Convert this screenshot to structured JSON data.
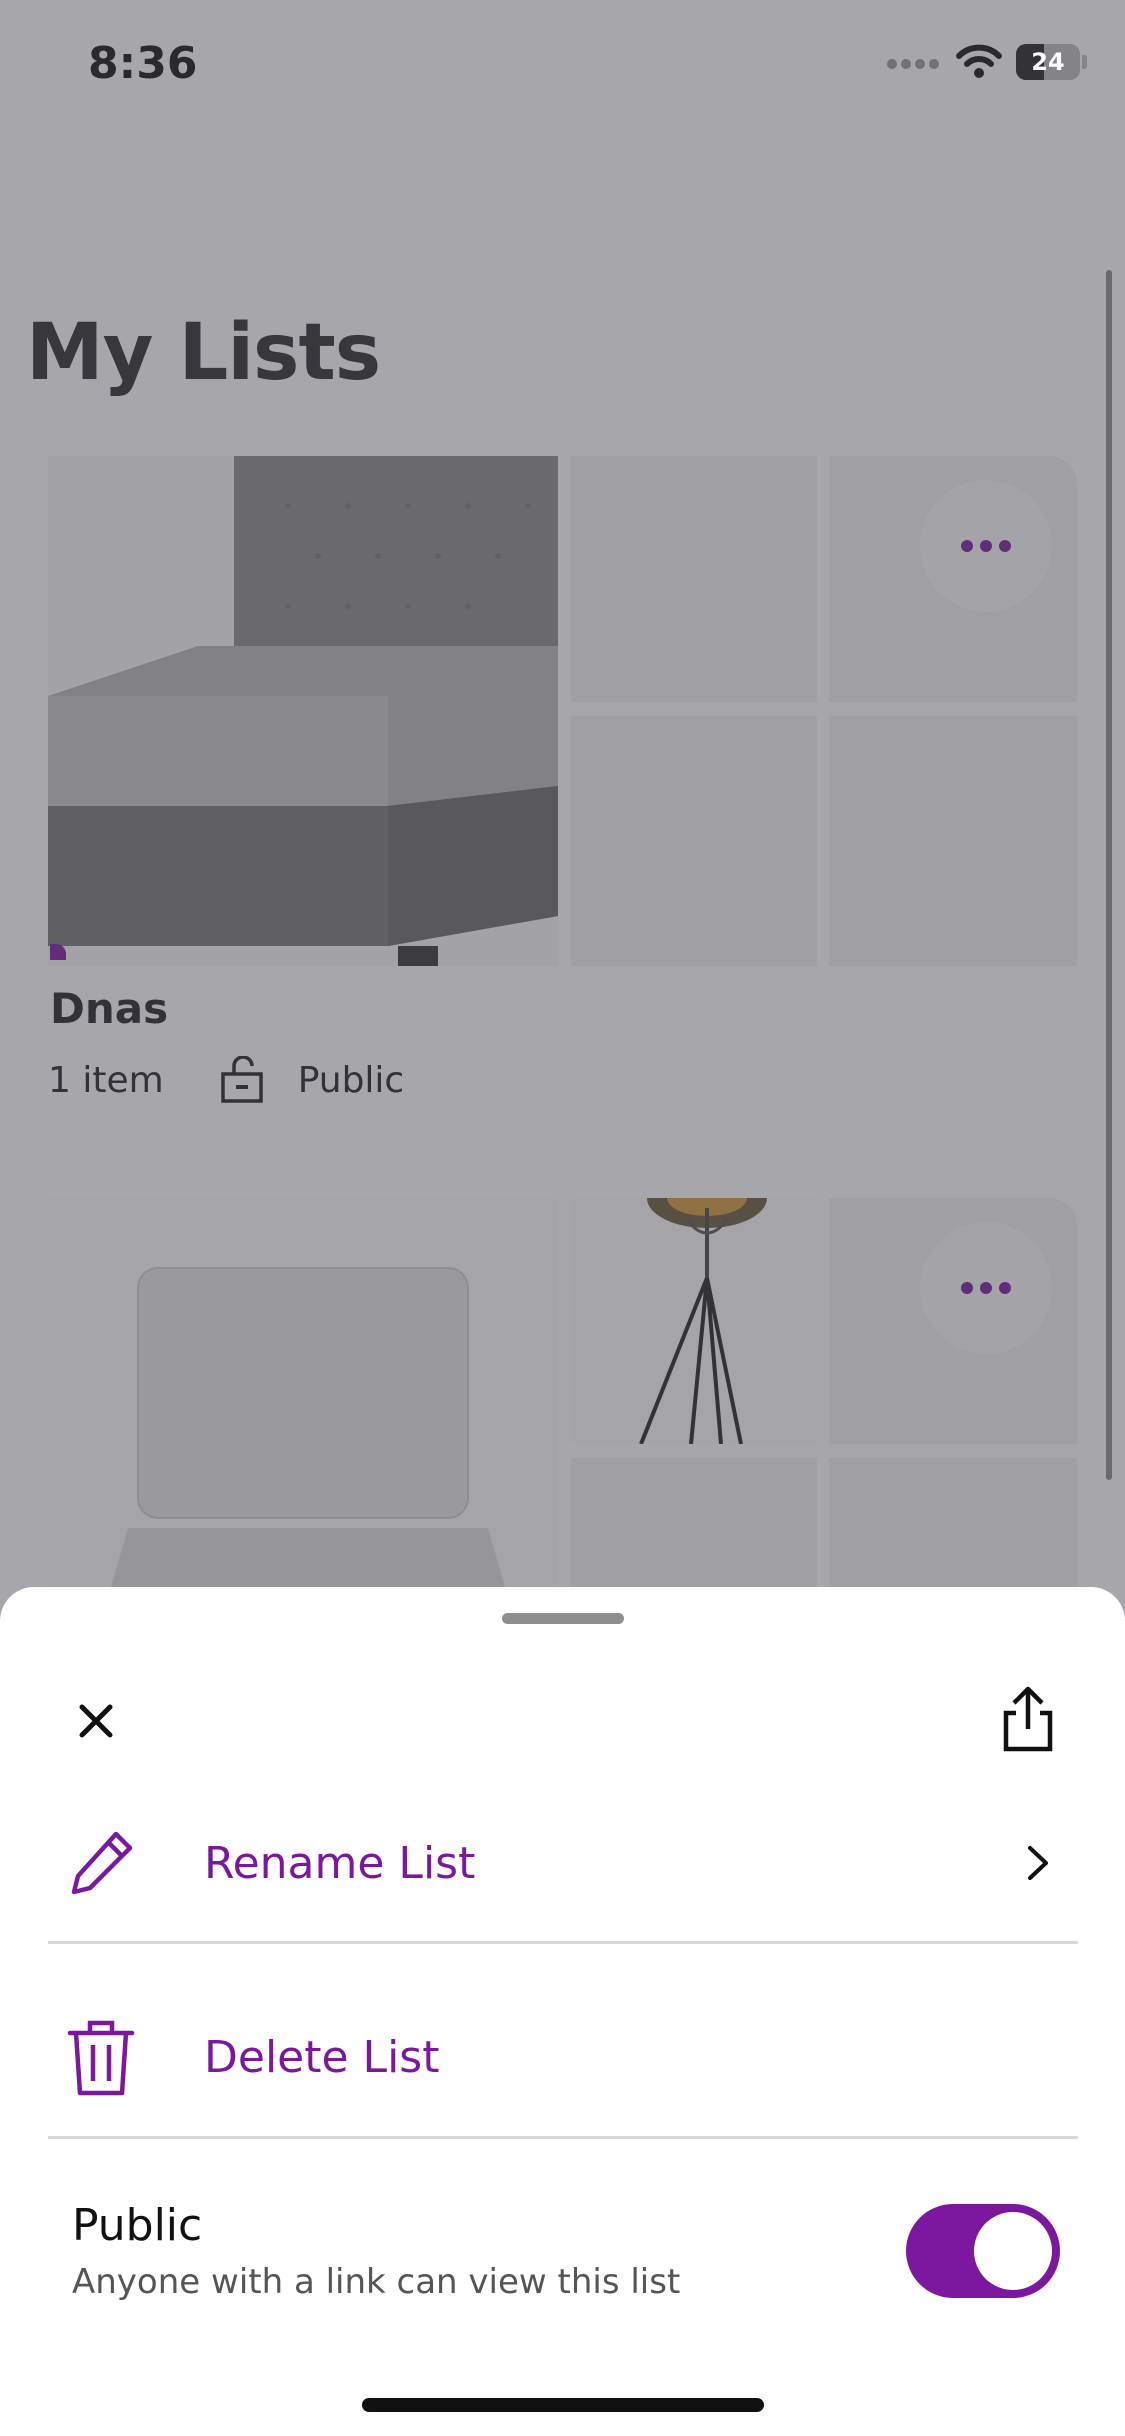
{
  "status_bar": {
    "time": "8:36",
    "battery": "24"
  },
  "page": {
    "title": "My Lists"
  },
  "lists": [
    {
      "name": "Dnas",
      "item_count": "1 item",
      "visibility": "Public"
    }
  ],
  "sheet": {
    "actions": [
      {
        "label": "Rename List",
        "icon": "pencil-icon",
        "has_chevron": true
      },
      {
        "label": "Delete List",
        "icon": "trash-icon",
        "has_chevron": false
      }
    ],
    "public_toggle": {
      "title": "Public",
      "subtitle": "Anyone with a link can view this list",
      "on": true
    }
  },
  "colors": {
    "accent": "#7b189f",
    "overlay": "#46465099"
  }
}
